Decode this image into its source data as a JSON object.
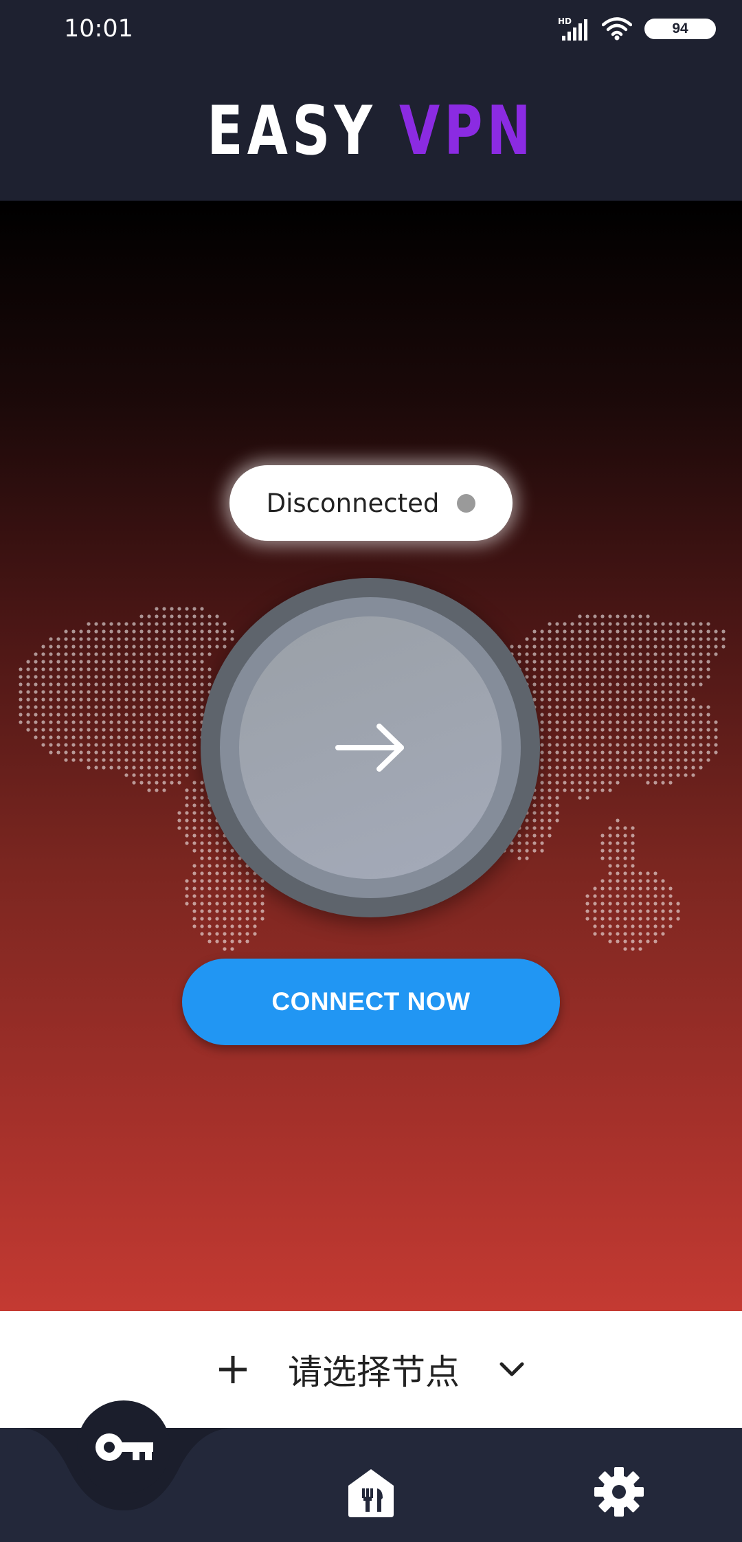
{
  "status_bar": {
    "time": "10:01",
    "battery": "94",
    "network_label": "HD"
  },
  "header": {
    "title_part1": "EASY",
    "title_part2": "VPN"
  },
  "connection": {
    "status_text": "Disconnected",
    "connect_label": "CONNECT NOW"
  },
  "node_selector": {
    "label": "请选择节点"
  },
  "colors": {
    "accent_purple": "#8b2be2",
    "connect_blue": "#2196f3",
    "nav_bg": "#23283a",
    "header_bg": "#1e2130"
  },
  "nav": {
    "items": [
      "key-icon",
      "restaurant-icon",
      "gear-icon"
    ]
  }
}
